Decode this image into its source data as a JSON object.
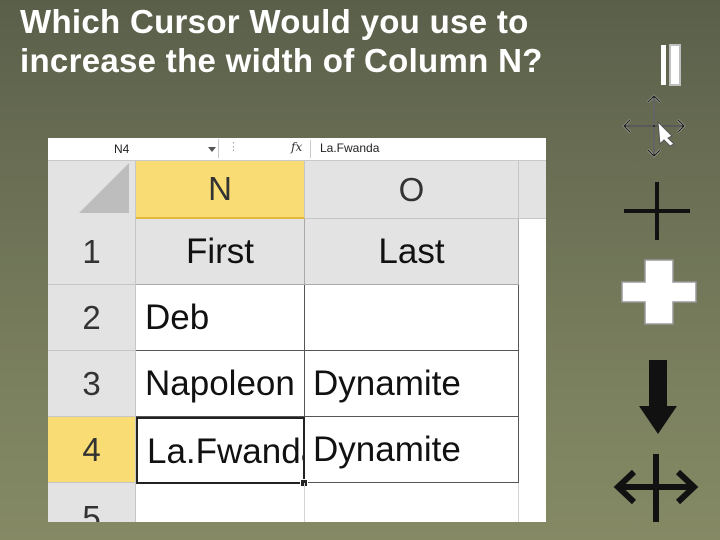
{
  "slide": {
    "title_line1": "Which Cursor Would you use to",
    "title_line2": "increase the width of Column N?"
  },
  "excel": {
    "name_box": "N4",
    "fx_label": "fx",
    "formula_value": "La.Fwanda",
    "columns": [
      "N",
      "O"
    ],
    "rows": [
      {
        "number": "1",
        "cells": [
          "First",
          "Last"
        ]
      },
      {
        "number": "2",
        "cells": [
          "Deb",
          ""
        ]
      },
      {
        "number": "3",
        "cells": [
          "Napoleon",
          "Dynamite"
        ]
      },
      {
        "number": "4",
        "cells": [
          "La.Fwanda",
          "Dynamite"
        ]
      },
      {
        "number": "5",
        "cells": [
          "",
          ""
        ]
      }
    ],
    "active_cell": "N4",
    "selection_color": "#f9dc73"
  },
  "cursors": [
    {
      "name": "move-cursor-icon"
    },
    {
      "name": "crosshair-cursor-icon"
    },
    {
      "name": "white-cross-cursor-icon"
    },
    {
      "name": "down-arrow-cursor-icon"
    },
    {
      "name": "column-resize-cursor-icon"
    }
  ]
}
